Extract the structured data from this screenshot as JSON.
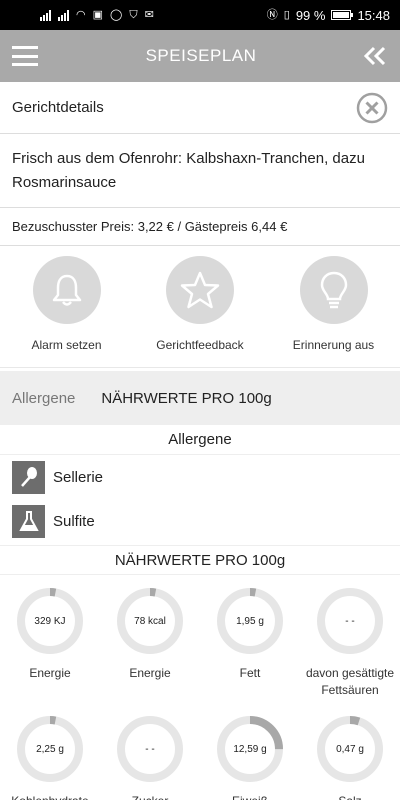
{
  "status": {
    "battery": "99 %",
    "time": "15:48"
  },
  "appbar": {
    "title": "SPEISEPLAN",
    "menu_icon": "hamburger-icon",
    "back_icon": "double-chevron-left-icon"
  },
  "details": {
    "title": "Gerichtdetails",
    "close_icon": "close-circle-icon"
  },
  "dish": {
    "name": "Frisch aus dem Ofenrohr: Kalbshaxn-Tranchen, dazu Rosmarinsauce"
  },
  "price": {
    "text": "Bezuschusster Preis: 3,22 € / Gästepreis 6,44 €"
  },
  "actions": [
    {
      "label": "Alarm setzen",
      "icon": "bell-icon"
    },
    {
      "label": "Gerichtfeedback",
      "icon": "star-icon"
    },
    {
      "label": "Erinnerung aus",
      "icon": "lightbulb-icon"
    }
  ],
  "tabs": [
    {
      "label": "Allergene",
      "active": false
    },
    {
      "label": "NÄHRWERTE PRO 100g",
      "active": true
    }
  ],
  "allergens": {
    "heading": "Allergene",
    "items": [
      {
        "label": "Sellerie",
        "icon": "celery-icon"
      },
      {
        "label": "Sulfite",
        "icon": "flask-icon"
      }
    ]
  },
  "nutrition": {
    "heading": "NÄHRWERTE PRO 100g",
    "colors": {
      "track": "#e6e6e6",
      "fill": "#a8a8a8"
    },
    "items": [
      {
        "value": "329 KJ",
        "label": "Energie",
        "fraction": 0.03
      },
      {
        "value": "78 kcal",
        "label": "Energie",
        "fraction": 0.03
      },
      {
        "value": "1,95 g",
        "label": "Fett",
        "fraction": 0.03
      },
      {
        "value": "- -",
        "label": "davon gesättigte Fettsäuren",
        "fraction": 0
      },
      {
        "value": "2,25 g",
        "label": "Kohlenhydrate",
        "fraction": 0.03
      },
      {
        "value": "- -",
        "label": "Zucker",
        "fraction": 0
      },
      {
        "value": "12,59 g",
        "label": "Eiweiß",
        "fraction": 0.25
      },
      {
        "value": "0,47 g",
        "label": "Salz",
        "fraction": 0.05
      }
    ]
  }
}
